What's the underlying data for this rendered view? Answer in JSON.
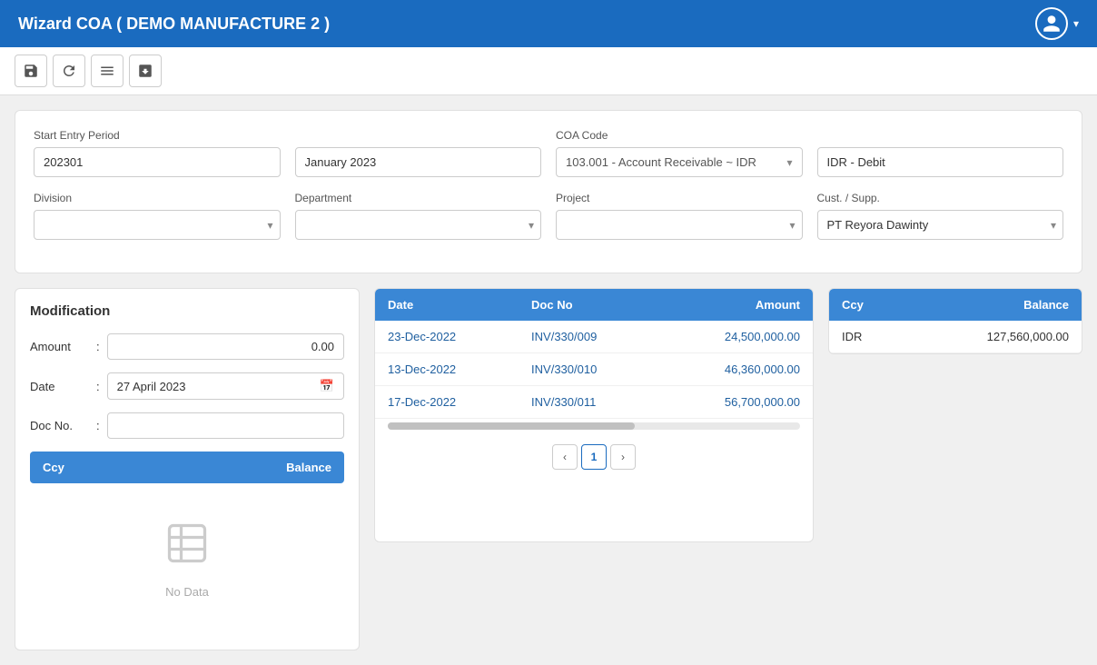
{
  "header": {
    "title": "Wizard COA ( DEMO MANUFACTURE 2 )"
  },
  "toolbar": {
    "buttons": [
      {
        "name": "save-icon",
        "symbol": "💾",
        "label": "Save"
      },
      {
        "name": "refresh-icon",
        "symbol": "↺",
        "label": "Refresh"
      },
      {
        "name": "list-icon",
        "symbol": "≡",
        "label": "List"
      },
      {
        "name": "export-icon",
        "symbol": "⬛",
        "label": "Export"
      }
    ]
  },
  "form": {
    "start_entry_period_label": "Start Entry Period",
    "start_entry_period_value": "202301",
    "month_value": "January 2023",
    "coa_code_label": "COA Code",
    "coa_code_value": "103.001 - Account Receivable ~ IDR",
    "coa_type_value": "IDR - Debit",
    "division_label": "Division",
    "division_placeholder": "",
    "department_label": "Department",
    "department_placeholder": "",
    "project_label": "Project",
    "project_placeholder": "",
    "cust_supp_label": "Cust. / Supp.",
    "cust_supp_value": "PT Reyora Dawinty"
  },
  "modification": {
    "title": "Modification",
    "amount_label": "Amount",
    "amount_value": "0.00",
    "date_label": "Date",
    "date_value": "27 April 2023",
    "docno_label": "Doc No.",
    "docno_value": "",
    "ccy_label": "Ccy",
    "balance_label": "Balance",
    "no_data_text": "No Data"
  },
  "transactions_table": {
    "columns": [
      "Date",
      "Doc No",
      "Amount"
    ],
    "rows": [
      {
        "date": "23-Dec-2022",
        "doc_no": "INV/330/009",
        "amount": "24,500,000.00"
      },
      {
        "date": "13-Dec-2022",
        "doc_no": "INV/330/010",
        "amount": "46,360,000.00"
      },
      {
        "date": "17-Dec-2022",
        "doc_no": "INV/330/011",
        "amount": "56,700,000.00"
      }
    ]
  },
  "pagination": {
    "current": "1"
  },
  "balance_table": {
    "ccy_label": "Ccy",
    "balance_label": "Balance",
    "rows": [
      {
        "ccy": "IDR",
        "balance": "127,560,000.00"
      }
    ]
  }
}
